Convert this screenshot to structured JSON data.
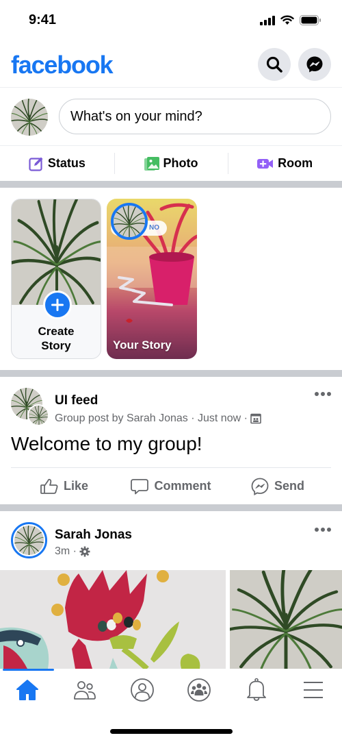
{
  "status_bar": {
    "time": "9:41",
    "icons": [
      "cellular-signal-icon",
      "wifi-icon",
      "battery-icon"
    ]
  },
  "header": {
    "logo": "facebook",
    "brand_color": "#1877f2",
    "buttons": [
      {
        "name": "search",
        "icon": "search-icon"
      },
      {
        "name": "messenger",
        "icon": "messenger-icon"
      }
    ]
  },
  "composer": {
    "placeholder": "What's on your mind?"
  },
  "quick_actions": [
    {
      "label": "Status",
      "icon": "edit-icon",
      "color": "#7a5ad6"
    },
    {
      "label": "Photo",
      "icon": "photo-icon",
      "color": "#45bd62"
    },
    {
      "label": "Room",
      "icon": "video-room-icon",
      "color": "#9360f7"
    }
  ],
  "stories": {
    "create": {
      "label_line1": "Create",
      "label_line2": "Story"
    },
    "your_story": {
      "label": "Your Story",
      "sticker_text": "NO"
    }
  },
  "posts": [
    {
      "title": "UI feed",
      "meta": "Group post by Sarah Jonas · Just now ·",
      "meta_icon": "group-privacy-icon",
      "text": "Welcome to my group!",
      "actions": [
        {
          "label": "Like",
          "icon": "thumbs-up-icon"
        },
        {
          "label": "Comment",
          "icon": "comment-icon"
        },
        {
          "label": "Send",
          "icon": "messenger-send-icon"
        }
      ]
    },
    {
      "author": "Sarah Jonas",
      "meta": "3m ·",
      "meta_icon": "gear-icon"
    }
  ],
  "tabbar": {
    "active": "home",
    "tabs": [
      {
        "name": "home",
        "icon": "home-icon"
      },
      {
        "name": "friends",
        "icon": "friends-icon"
      },
      {
        "name": "profile",
        "icon": "profile-icon"
      },
      {
        "name": "groups",
        "icon": "groups-icon"
      },
      {
        "name": "notifications",
        "icon": "bell-icon"
      },
      {
        "name": "menu",
        "icon": "menu-icon"
      }
    ]
  }
}
